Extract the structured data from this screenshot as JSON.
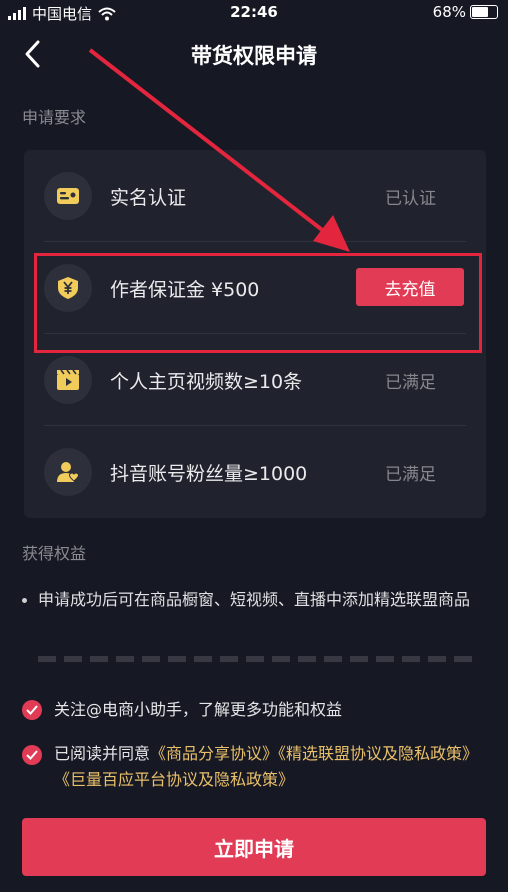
{
  "status_bar": {
    "carrier": "中国电信",
    "time": "22:46",
    "battery": "68%",
    "battery_level": 0.68
  },
  "header": {
    "title": "带货权限申请"
  },
  "requirements": {
    "label": "申请要求",
    "items": [
      {
        "label": "实名认证",
        "status": "已认证",
        "icon": "id-card-icon"
      },
      {
        "label": "作者保证金 ¥500",
        "action": "去充值",
        "icon": "yuan-shield-icon"
      },
      {
        "label": "个人主页视频数≥10条",
        "status": "已满足",
        "icon": "video-clapper-icon"
      },
      {
        "label": "抖音账号粉丝量≥1000",
        "status": "已满足",
        "icon": "fans-icon"
      }
    ]
  },
  "benefits": {
    "label": "获得权益",
    "items": [
      "申请成功后可在商品橱窗、短视频、直播中添加精选联盟商品"
    ]
  },
  "agreements": {
    "follow_text": "关注@电商小助手，了解更多功能和权益",
    "read_prefix": "已阅读并同意",
    "links": [
      "《商品分享协议》",
      "《精选联盟协议及隐私政策》",
      "《巨量百应平台协议及隐私政策》"
    ]
  },
  "apply_button": "立即申请",
  "colors": {
    "background": "#161823",
    "card": "#20222d",
    "accent": "#e13b56",
    "highlight": "#e3263d",
    "gold": "#e9c06a",
    "icon_gold": "#f1cc5a"
  }
}
